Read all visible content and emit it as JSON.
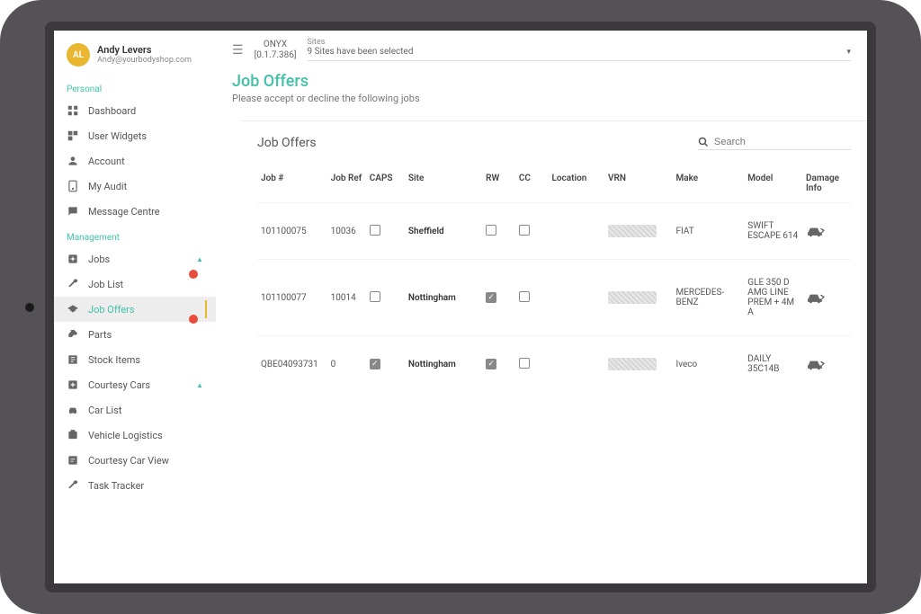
{
  "user": {
    "initials": "AL",
    "name": "Andy Levers",
    "email": "Andy@yourbodyshop.com"
  },
  "sidebar": {
    "section_personal": "Personal",
    "section_management": "Management",
    "items": {
      "dashboard": "Dashboard",
      "user_widgets": "User Widgets",
      "account": "Account",
      "my_audit": "My Audit",
      "message_centre": "Message Centre",
      "jobs": "Jobs",
      "job_list": "Job List",
      "job_offers": "Job Offers",
      "parts": "Parts",
      "stock_items": "Stock Items",
      "courtesy_cars": "Courtesy Cars",
      "car_list": "Car List",
      "vehicle_logistics": "Vehicle Logistics",
      "courtesy_car_view": "Courtesy Car View",
      "task_tracker": "Task Tracker"
    }
  },
  "topbar": {
    "brand": "ONYX",
    "version": "[0.1.7.386]",
    "sites_label": "Sites",
    "sites_value": "9 Sites have been selected"
  },
  "page": {
    "title": "Job Offers",
    "subtitle": "Please accept or decline the following jobs",
    "card_title": "Job Offers",
    "search_placeholder": "Search"
  },
  "table": {
    "headers": {
      "job_no": "Job #",
      "job_ref": "Job Ref",
      "caps": "CAPS",
      "site": "Site",
      "rw": "RW",
      "cc": "CC",
      "location": "Location",
      "vrn": "VRN",
      "make": "Make",
      "model": "Model",
      "damage": "Damage Info"
    },
    "rows": [
      {
        "job_no": "101100075",
        "job_ref": "10036",
        "caps": false,
        "site": "Sheffield",
        "rw": false,
        "cc": false,
        "location": "",
        "make": "FIAT",
        "model": "SWIFT ESCAPE 614"
      },
      {
        "job_no": "101100077",
        "job_ref": "10014",
        "caps": false,
        "site": "Nottingham",
        "rw": true,
        "cc": false,
        "location": "",
        "make": "MERCEDES-BENZ",
        "model": "GLE 350 D AMG LINE PREM + 4M A"
      },
      {
        "job_no": "QBE04093731",
        "job_ref": "0",
        "caps": true,
        "site": "Nottingham",
        "rw": true,
        "cc": false,
        "location": "",
        "make": "Iveco",
        "model": "DAILY 35C14B"
      }
    ]
  }
}
